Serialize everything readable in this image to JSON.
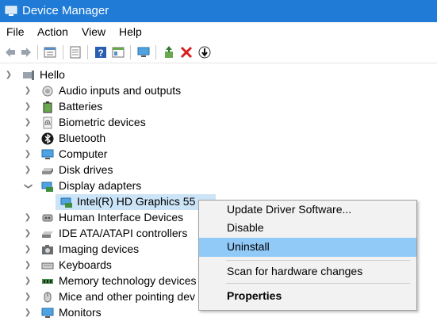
{
  "window": {
    "title": "Device Manager"
  },
  "menubar": {
    "items": [
      "File",
      "Action",
      "View",
      "Help"
    ]
  },
  "toolbar": {
    "buttons": [
      "back-icon",
      "forward-icon",
      "properties-icon",
      "refresh-icon",
      "help-icon",
      "view-icon",
      "monitor-scan-icon",
      "update-driver-icon",
      "uninstall-icon",
      "download-icon"
    ]
  },
  "tree": {
    "root": "Hello",
    "categories": [
      {
        "label": "Audio inputs and outputs",
        "icon": "speaker-icon"
      },
      {
        "label": "Batteries",
        "icon": "battery-icon"
      },
      {
        "label": "Biometric devices",
        "icon": "fingerprint-icon"
      },
      {
        "label": "Bluetooth",
        "icon": "bluetooth-icon"
      },
      {
        "label": "Computer",
        "icon": "computer-icon"
      },
      {
        "label": "Disk drives",
        "icon": "disk-icon"
      },
      {
        "label": "Display adapters",
        "icon": "display-adapter-icon",
        "expanded": true
      },
      {
        "label": "Human Interface Devices",
        "icon": "hid-icon"
      },
      {
        "label": "IDE ATA/ATAPI controllers",
        "icon": "ide-icon"
      },
      {
        "label": "Imaging devices",
        "icon": "camera-icon"
      },
      {
        "label": "Keyboards",
        "icon": "keyboard-icon"
      },
      {
        "label": "Memory technology devices",
        "icon": "memory-icon"
      },
      {
        "label": "Mice and other pointing dev",
        "icon": "mouse-icon"
      },
      {
        "label": "Monitors",
        "icon": "monitor-icon"
      }
    ],
    "child": {
      "label": "Intel(R) HD Graphics 55",
      "icon": "display-adapter-icon"
    }
  },
  "context_menu": {
    "items": [
      "Update Driver Software...",
      "Disable",
      "Uninstall",
      "Scan for hardware changes",
      "Properties"
    ],
    "highlighted": "Uninstall"
  },
  "colors": {
    "titlebar": "#1f7bd6",
    "selection": "#cce4f7",
    "menu_highlight": "#91c9f7"
  }
}
